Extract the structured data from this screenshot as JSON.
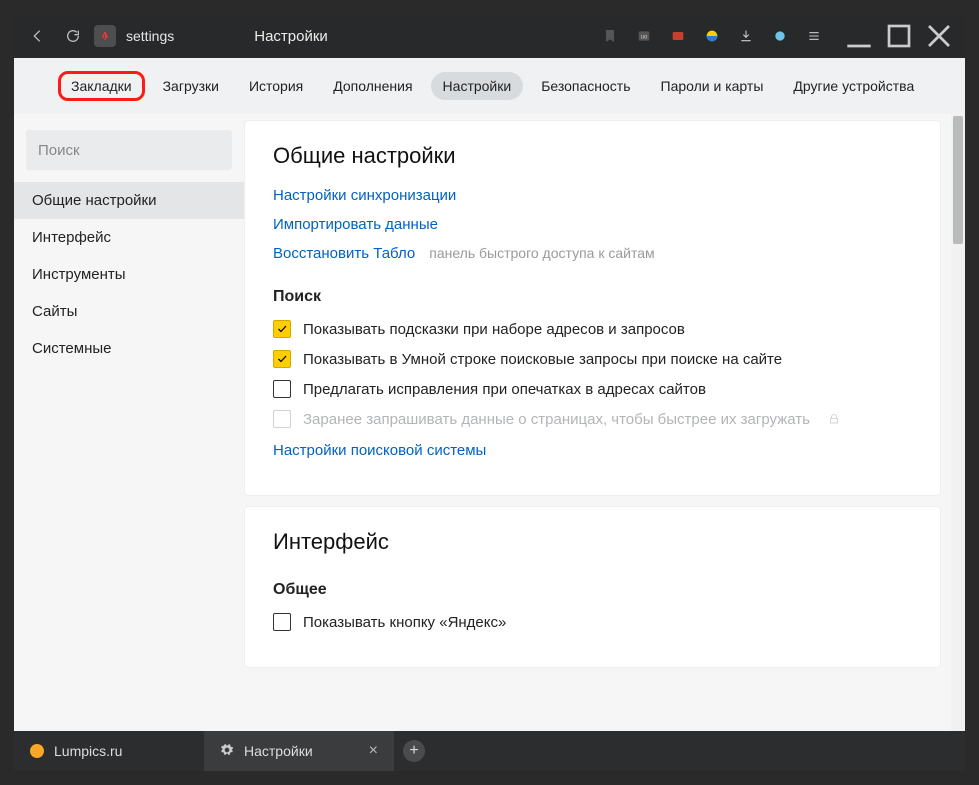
{
  "titlebar": {
    "address_text": "settings",
    "page_title": "Настройки"
  },
  "topnav": {
    "items": [
      "Закладки",
      "Загрузки",
      "История",
      "Дополнения",
      "Настройки",
      "Безопасность",
      "Пароли и карты",
      "Другие устройства"
    ],
    "highlighted_index": 0,
    "active_index": 4
  },
  "sidebar": {
    "search_placeholder": "Поиск",
    "items": [
      "Общие настройки",
      "Интерфейс",
      "Инструменты",
      "Сайты",
      "Системные"
    ],
    "active_index": 0
  },
  "main": {
    "general": {
      "title": "Общие настройки",
      "links": {
        "sync": "Настройки синхронизации",
        "import": "Импортировать данные",
        "restore": "Восстановить Табло",
        "restore_note": "панель быстрого доступа к сайтам"
      },
      "search_section_title": "Поиск",
      "checkboxes": [
        {
          "label": "Показывать подсказки при наборе адресов и запросов",
          "checked": true,
          "disabled": false
        },
        {
          "label": "Показывать в Умной строке поисковые запросы при поиске на сайте",
          "checked": true,
          "disabled": false
        },
        {
          "label": "Предлагать исправления при опечатках в адресах сайтов",
          "checked": false,
          "disabled": false
        },
        {
          "label": "Заранее запрашивать данные о страницах, чтобы быстрее их загружать",
          "checked": false,
          "disabled": true,
          "locked": true
        }
      ],
      "search_settings_link": "Настройки поисковой системы"
    },
    "interface": {
      "title": "Интерфейс",
      "subsection": "Общее",
      "checkbox_label": "Показывать кнопку «Яндекс»"
    }
  },
  "tabstrip": {
    "tabs": [
      {
        "label": "Lumpics.ru",
        "icon": "orange-dot"
      },
      {
        "label": "Настройки",
        "icon": "gear",
        "active": true
      }
    ]
  },
  "colors": {
    "accent_link": "#0062c3",
    "check_fill": "#fece00"
  }
}
